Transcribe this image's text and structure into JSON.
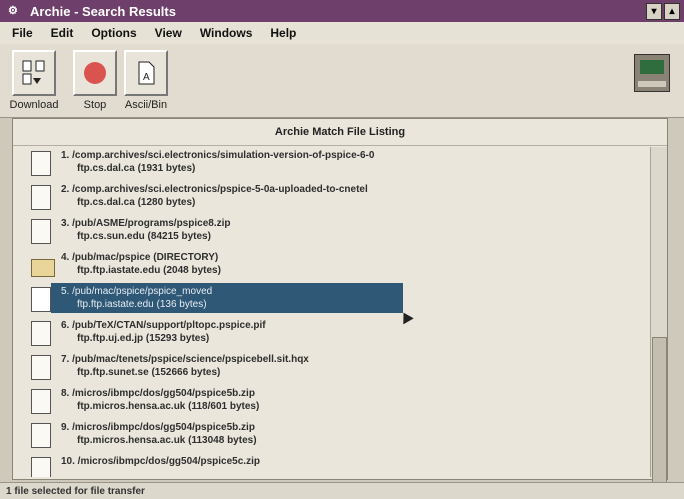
{
  "window": {
    "title": "Archie - Search Results"
  },
  "menu": [
    "File",
    "Edit",
    "Options",
    "View",
    "Windows",
    "Help"
  ],
  "toolbar": {
    "download_label": "Download",
    "stop_label": "Stop",
    "ascii_label": "Ascii/Bin"
  },
  "list": {
    "header": "Archie Match File Listing",
    "items": [
      {
        "path": "1. /comp.archives/sci.electronics/simulation-version-of-pspice-6-0",
        "info": "ftp.cs.dal.ca (1931 bytes)",
        "type": "file"
      },
      {
        "path": "2. /comp.archives/sci.electronics/pspice-5-0a-uploaded-to-cnetel",
        "info": "ftp.cs.dal.ca (1280 bytes)",
        "type": "file"
      },
      {
        "path": "3. /pub/ASME/programs/pspice8.zip",
        "info": "ftp.cs.sun.edu (84215 bytes)",
        "type": "file"
      },
      {
        "path": "4. /pub/mac/pspice (DIRECTORY)",
        "info": "ftp.ftp.iastate.edu (2048 bytes)",
        "type": "folder"
      },
      {
        "path": "5. /pub/mac/pspice/pspice_moved",
        "info": "ftp.ftp.iastate.edu (136 bytes)",
        "type": "file",
        "selected": true
      },
      {
        "path": "6. /pub/TeX/CTAN/support/pltopc.pspice.pif",
        "info": "ftp.ftp.uj.ed.jp (15293 bytes)",
        "type": "file"
      },
      {
        "path": "7. /pub/mac/tenets/pspice/science/pspicebell.sit.hqx",
        "info": "ftp.ftp.sunet.se (152666 bytes)",
        "type": "file"
      },
      {
        "path": "8. /micros/ibmpc/dos/gg504/pspice5b.zip",
        "info": "ftp.micros.hensa.ac.uk (118/601 bytes)",
        "type": "file"
      },
      {
        "path": "9. /micros/ibmpc/dos/gg504/pspice5b.zip",
        "info": "ftp.micros.hensa.ac.uk (113048 bytes)",
        "type": "file"
      },
      {
        "path": "10. /micros/ibmpc/dos/gg504/pspice5c.zip",
        "info": "",
        "type": "file"
      }
    ]
  },
  "status": "1 file selected for file transfer"
}
